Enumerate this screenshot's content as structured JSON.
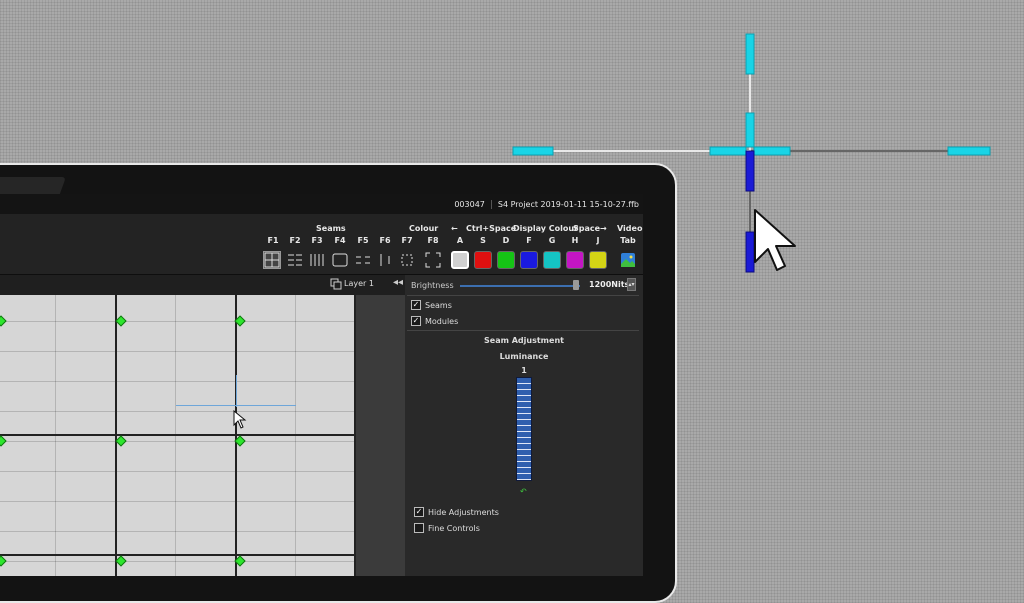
{
  "window": {
    "id": "003047",
    "filename": "S4 Project 2019-01-11 15-10-27.ffb"
  },
  "toolbar": {
    "seams_header": "Seams",
    "colour_header": "Colour",
    "ctrl_space": "Ctrl+Space",
    "display_colour": "Display Colour",
    "space": "Space",
    "arrow_left": "←",
    "arrow_right": "→",
    "video_label": "Video",
    "tab_label": "Tab",
    "seam_keys": [
      "F1",
      "F2",
      "F3",
      "F4",
      "F5",
      "F6"
    ],
    "colour_keys": [
      "F7",
      "F8"
    ],
    "display_keys": [
      "A",
      "S",
      "D",
      "F",
      "G",
      "H",
      "J"
    ],
    "display_colours": [
      "#d0d0d0",
      "#e01010",
      "#15c415",
      "#1a1ae0",
      "#15c4c4",
      "#c415c4",
      "#d4d415"
    ],
    "seam_icons": [
      "grid-icon",
      "horizontal-dashes-icon",
      "vertical-lines-icon",
      "rectangle-icon",
      "dashed-lines-icon",
      "single-line-icon"
    ],
    "colour_icons": [
      "small-frame-icon",
      "corner-frame-icon"
    ],
    "video_icon": "landscape-image-icon"
  },
  "layerbar": {
    "layer_name": "Layer 1",
    "layer_icon": "layers-icon",
    "collapse_icon": "double-chevron-left-icon"
  },
  "right_panel": {
    "brightness_label": "Brightness",
    "brightness_value": "1200Nits",
    "brightness_level": 0.97,
    "seams_checked": true,
    "seams_label": "Seams",
    "modules_checked": true,
    "modules_label": "Modules",
    "seam_adjustment_title": "Seam Adjustment",
    "luminance_label": "Luminance",
    "luminance_value": "1",
    "reset_icon": "reset-arrow-icon",
    "hide_adjustments_checked": true,
    "hide_adjustments_label": "Hide Adjustments",
    "fine_controls_checked": false,
    "fine_controls_label": "Fine Controls"
  },
  "overlay": {
    "crosshair_icon": "seam-crosshair-icon",
    "cursor_icon": "mouse-pointer-icon",
    "accent_cyan": "#19d4e6",
    "accent_blue": "#1a1ad6"
  }
}
